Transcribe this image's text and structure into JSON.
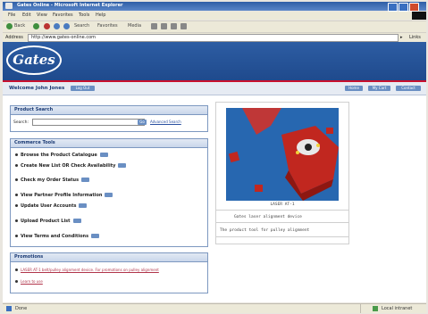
{
  "window": {
    "title": "Gates Online - Microsoft Internet Explorer"
  },
  "menu": [
    "File",
    "Edit",
    "View",
    "Favorites",
    "Tools",
    "Help"
  ],
  "toolbar": {
    "back": "Back",
    "search": "Search",
    "favorites": "Favorites",
    "media": "Media"
  },
  "address": {
    "label": "Address",
    "url": "http://www.gates-online.com",
    "links": "Links"
  },
  "brand": {
    "logo_text": "Gates",
    "accent": "#c8102e",
    "header_blue": "#2d5da3"
  },
  "welcome": {
    "text": "Welcome John Jones",
    "badge": "Log Out",
    "right_buttons": [
      "Home",
      "My Cart",
      "Contact"
    ]
  },
  "search_panel": {
    "title": "Product Search",
    "label": "Search:",
    "go": "Go",
    "advanced": "Advanced Search"
  },
  "commerce_panel": {
    "title": "Commerce Tools",
    "items": [
      "Browse the Product Catalogue",
      "Create New List OR Check Availability",
      "Check my Order Status",
      "View Partner Profile Information",
      "Update User Accounts",
      "Upload Product List",
      "View Terms and Conditions"
    ]
  },
  "promotions_panel": {
    "title": "Promotions",
    "items": [
      "LASER AT-1 belt/pulley alignment device. For promotions on pulley alignment",
      "Learn to use"
    ]
  },
  "product": {
    "code": "LASER AT-1",
    "name": "Gates laser alignment device",
    "description": "The product tool for pulley alignment"
  },
  "status": {
    "left": "Done",
    "zone": "Local intranet"
  }
}
